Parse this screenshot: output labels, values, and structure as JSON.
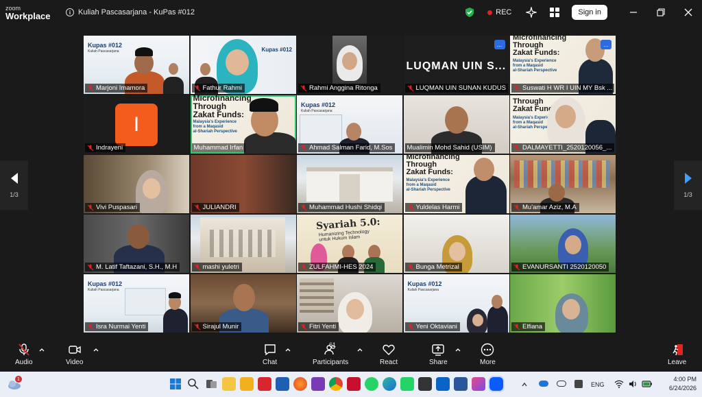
{
  "app": {
    "brand_line1": "zoom",
    "brand_line2": "Workplace",
    "meeting_title": "Kuliah Pascasarjana - KuPas #012",
    "rec_label": "REC",
    "signin_label": "Sign in"
  },
  "gallery": {
    "page_indicator_left": "1/3",
    "page_indicator_right": "1/3",
    "slide_texts": {
      "kupas": "Kupas #012",
      "kuliah": "Kuliah Pascasarjana",
      "zakat_line1": "Microfinancing",
      "zakat_line2": "Through",
      "zakat_line3": "Zakat Funds:",
      "zakat_sub1": "Malaysia's Experience",
      "zakat_sub2": "from a Maqasid",
      "zakat_sub3": "al-Shariah Perspective",
      "syariah_title": "Syariah 5.0:",
      "syariah_sub1": "Humanizing Technology",
      "syariah_sub2": "untuk Hukum Islam",
      "luqman_big": "LUQMAN UIN S...",
      "avatar_letter": "I",
      "more_dots": "..."
    },
    "tiles": [
      {
        "name": "Marjoni Imamora"
      },
      {
        "name": "Fathur Rahmi"
      },
      {
        "name": "Rahmi Anggina Ritonga"
      },
      {
        "name": "LUQMAN UIN SUNAN KUDUS"
      },
      {
        "name": "Suswati H WR I UIN MY Bsk ..."
      },
      {
        "name": "Indrayeni"
      },
      {
        "name": "Muhammad Irfan"
      },
      {
        "name": "Ahmad Salman Farid, M.Sos"
      },
      {
        "name": "Mualimin Mohd Sahid (USIM)"
      },
      {
        "name": "DALMAYETTI_2520120056_..."
      },
      {
        "name": "Vivi Puspasari"
      },
      {
        "name": "JULIANDRI"
      },
      {
        "name": "Muhammad Hushi Shidqi"
      },
      {
        "name": "Yuldelas Harmi"
      },
      {
        "name": "Mu'amar Aziz, M.A"
      },
      {
        "name": "M. Latif Taftazani, S.H., M.H"
      },
      {
        "name": "mashi yuletri"
      },
      {
        "name": "ZULFAHMI-HES 2024"
      },
      {
        "name": "Bunga Metrizal"
      },
      {
        "name": "EVANURSANTI 2520120050"
      },
      {
        "name": "Isra Nurmai Yenti"
      },
      {
        "name": "Sirajul Munir"
      },
      {
        "name": "Fitri Yenti"
      },
      {
        "name": "Yeni Oktaviani"
      },
      {
        "name": "Elfiana"
      }
    ]
  },
  "toolbar": {
    "audio": "Audio",
    "video": "Video",
    "chat": "Chat",
    "participants": "Participants",
    "participants_count": "61",
    "react": "React",
    "share": "Share",
    "more": "More",
    "leave": "Leave"
  },
  "taskbar": {
    "weather_badge": "1",
    "language": "ENG",
    "time": "4:00 PM",
    "date": "6/24/2026"
  },
  "colors": {
    "active_speaker": "#2ecc71",
    "rec_dot": "#e02424",
    "avatar_bg": "#f45c1e",
    "more_btn": "#2d6cdf"
  }
}
